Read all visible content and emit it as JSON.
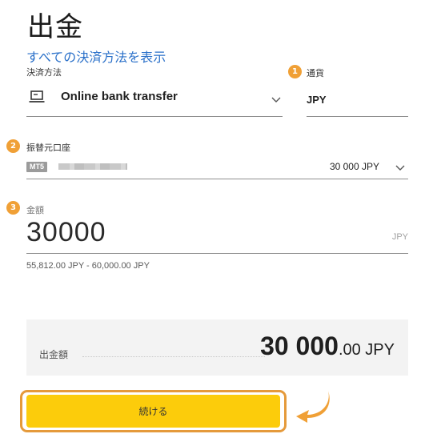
{
  "page": {
    "title": "出金"
  },
  "links": {
    "all_methods": "すべての決済方法を表示"
  },
  "payment_method": {
    "label": "決済方法",
    "value": "Online bank transfer",
    "icon": "laptop-icon"
  },
  "currency": {
    "step": "1",
    "label": "通貨",
    "value": "JPY"
  },
  "source_account": {
    "step": "2",
    "label": "振替元口座",
    "platform_badge": "MT5",
    "balance": "30 000 JPY"
  },
  "amount": {
    "step": "3",
    "label": "金額",
    "value": "30000",
    "unit": "JPY",
    "limits": "55,812.00 JPY  -  60,000.00 JPY"
  },
  "summary": {
    "label": "出金額",
    "amount_main": "30 000",
    "amount_decimal": ".00",
    "amount_currency": " JPY"
  },
  "actions": {
    "continue_label": "続ける"
  },
  "colors": {
    "accent_orange": "#f0a036",
    "button_yellow": "#fccc0b",
    "link_blue": "#2a70c9",
    "highlight_border": "#e59a3b"
  }
}
